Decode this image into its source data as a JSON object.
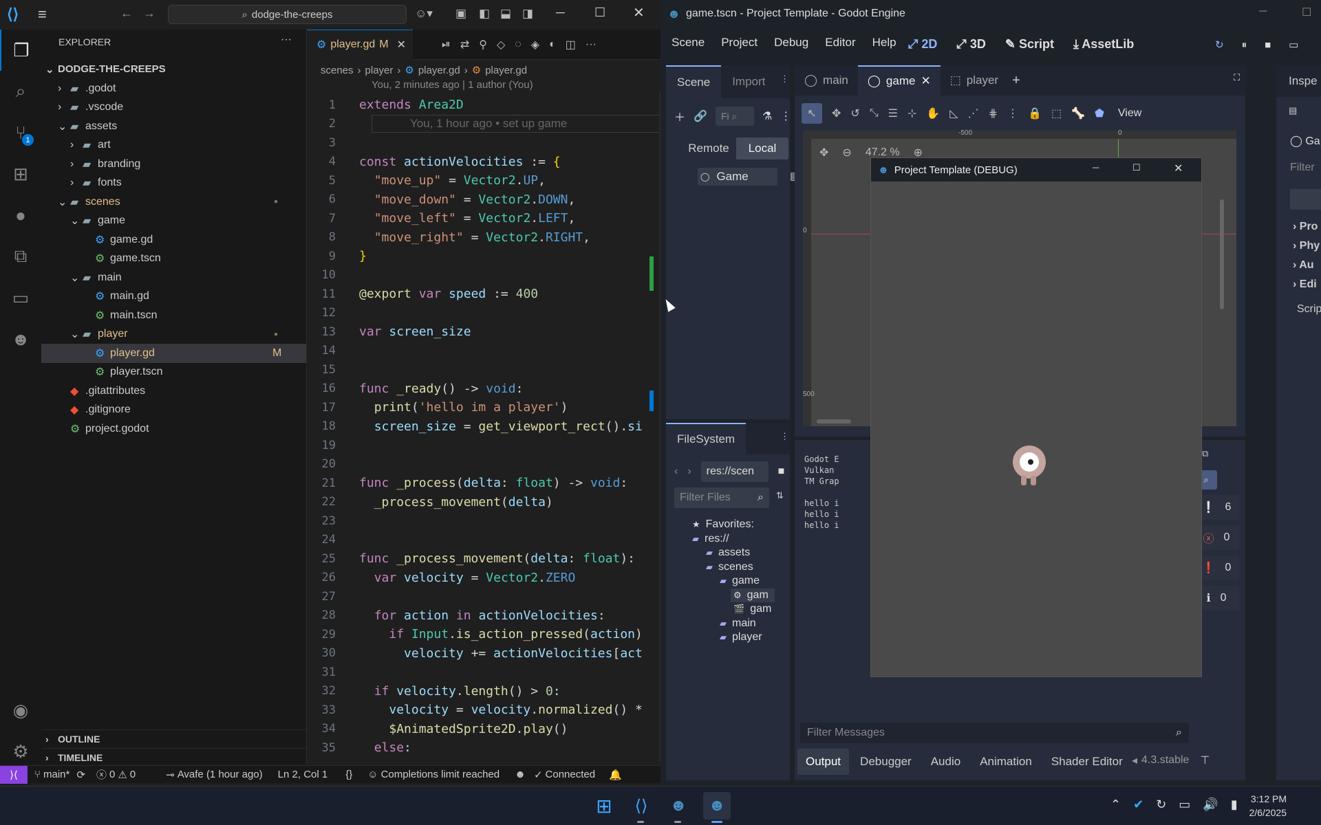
{
  "vscode": {
    "search": "dodge-the-creeps",
    "explorer_title": "EXPLORER",
    "root": "DODGE-THE-CREEPS",
    "tree": [
      {
        "label": ".godot",
        "depth": 1,
        "kind": "folder-closed",
        "color": "#ccc"
      },
      {
        "label": ".vscode",
        "depth": 1,
        "kind": "folder-closed",
        "color": "#ccc"
      },
      {
        "label": "assets",
        "depth": 1,
        "kind": "folder-open",
        "color": "#ccc"
      },
      {
        "label": "art",
        "depth": 2,
        "kind": "folder-closed",
        "color": "#ccc"
      },
      {
        "label": "branding",
        "depth": 2,
        "kind": "folder-closed",
        "color": "#ccc"
      },
      {
        "label": "fonts",
        "depth": 2,
        "kind": "folder-closed",
        "color": "#ccc"
      },
      {
        "label": "scenes",
        "depth": 1,
        "kind": "folder-open",
        "color": "#e2c08d",
        "dot": true
      },
      {
        "label": "game",
        "depth": 2,
        "kind": "folder-open",
        "color": "#ccc"
      },
      {
        "label": "game.gd",
        "depth": 3,
        "kind": "gd",
        "color": "#ccc"
      },
      {
        "label": "game.tscn",
        "depth": 3,
        "kind": "tscn",
        "color": "#ccc"
      },
      {
        "label": "main",
        "depth": 2,
        "kind": "folder-open",
        "color": "#ccc"
      },
      {
        "label": "main.gd",
        "depth": 3,
        "kind": "gd",
        "color": "#ccc"
      },
      {
        "label": "main.tscn",
        "depth": 3,
        "kind": "tscn",
        "color": "#ccc"
      },
      {
        "label": "player",
        "depth": 2,
        "kind": "folder-open",
        "color": "#e2c08d",
        "dot": true
      },
      {
        "label": "player.gd",
        "depth": 3,
        "kind": "gd",
        "color": "#e2c08d",
        "badge": "M",
        "selected": true
      },
      {
        "label": "player.tscn",
        "depth": 3,
        "kind": "tscn",
        "color": "#ccc"
      },
      {
        "label": ".gitattributes",
        "depth": 1,
        "kind": "git",
        "color": "#ccc"
      },
      {
        "label": ".gitignore",
        "depth": 1,
        "kind": "git",
        "color": "#ccc"
      },
      {
        "label": "project.godot",
        "depth": 1,
        "kind": "tscn",
        "color": "#ccc"
      }
    ],
    "outline": "OUTLINE",
    "timeline": "TIMELINE",
    "tab_label": "player.gd",
    "tab_badge": "M",
    "breadcrumb": [
      "scenes",
      "player",
      "player.gd",
      "player.gd"
    ],
    "blame": "You, 2 minutes ago | 1 author (You)",
    "inline_blame": "You, 1 hour ago • set up game",
    "code": [
      [
        [
          "kw",
          "extends "
        ],
        [
          "ty",
          "Area2D"
        ]
      ],
      [],
      [],
      [
        [
          "kw",
          "const "
        ],
        [
          "vr",
          "actionVelocities"
        ],
        [
          "pl",
          " := "
        ],
        [
          "yl",
          "{"
        ]
      ],
      [
        [
          "pl",
          "  "
        ],
        [
          "st",
          "\"move_up\""
        ],
        [
          "pl",
          " = "
        ],
        [
          "ty",
          "Vector2"
        ],
        [
          "pl",
          "."
        ],
        [
          "kw2",
          "UP"
        ],
        [
          "pl",
          ","
        ]
      ],
      [
        [
          "pl",
          "  "
        ],
        [
          "st",
          "\"move_down\""
        ],
        [
          "pl",
          " = "
        ],
        [
          "ty",
          "Vector2"
        ],
        [
          "pl",
          "."
        ],
        [
          "kw2",
          "DOWN"
        ],
        [
          "pl",
          ","
        ]
      ],
      [
        [
          "pl",
          "  "
        ],
        [
          "st",
          "\"move_left\""
        ],
        [
          "pl",
          " = "
        ],
        [
          "ty",
          "Vector2"
        ],
        [
          "pl",
          "."
        ],
        [
          "kw2",
          "LEFT"
        ],
        [
          "pl",
          ","
        ]
      ],
      [
        [
          "pl",
          "  "
        ],
        [
          "st",
          "\"move_right\""
        ],
        [
          "pl",
          " = "
        ],
        [
          "ty",
          "Vector2"
        ],
        [
          "pl",
          "."
        ],
        [
          "kw2",
          "RIGHT"
        ],
        [
          "pl",
          ","
        ]
      ],
      [
        [
          "yl",
          "}"
        ]
      ],
      [],
      [
        [
          "fn",
          "@export "
        ],
        [
          "kw",
          "var "
        ],
        [
          "vr",
          "speed"
        ],
        [
          "pl",
          " := "
        ],
        [
          "nu",
          "400"
        ]
      ],
      [],
      [
        [
          "kw",
          "var "
        ],
        [
          "vr",
          "screen_size"
        ]
      ],
      [],
      [],
      [
        [
          "kw",
          "func "
        ],
        [
          "fn",
          "_ready"
        ],
        [
          "pl",
          "() -> "
        ],
        [
          "kw2",
          "void"
        ],
        [
          "pl",
          ":"
        ]
      ],
      [
        [
          "pl",
          "  "
        ],
        [
          "fn",
          "print"
        ],
        [
          "pl",
          "("
        ],
        [
          "st",
          "'hello im a player'"
        ],
        [
          "pl",
          ")"
        ]
      ],
      [
        [
          "pl",
          "  "
        ],
        [
          "vr",
          "screen_size"
        ],
        [
          "pl",
          " = "
        ],
        [
          "fn",
          "get_viewport_rect"
        ],
        [
          "pl",
          "()."
        ],
        [
          "vr",
          "si"
        ]
      ],
      [],
      [],
      [
        [
          "kw",
          "func "
        ],
        [
          "fn",
          "_process"
        ],
        [
          "pl",
          "("
        ],
        [
          "vr",
          "delta"
        ],
        [
          "pl",
          ": "
        ],
        [
          "ty",
          "float"
        ],
        [
          "pl",
          ") -> "
        ],
        [
          "kw2",
          "void"
        ],
        [
          "pl",
          ":"
        ]
      ],
      [
        [
          "pl",
          "  "
        ],
        [
          "fn",
          "_process_movement"
        ],
        [
          "pl",
          "("
        ],
        [
          "vr",
          "delta"
        ],
        [
          "pl",
          ")"
        ]
      ],
      [],
      [],
      [
        [
          "kw",
          "func "
        ],
        [
          "fn",
          "_process_movement"
        ],
        [
          "pl",
          "("
        ],
        [
          "vr",
          "delta"
        ],
        [
          "pl",
          ": "
        ],
        [
          "ty",
          "float"
        ],
        [
          "pl",
          "):"
        ]
      ],
      [
        [
          "pl",
          "  "
        ],
        [
          "kw",
          "var "
        ],
        [
          "vr",
          "velocity"
        ],
        [
          "pl",
          " = "
        ],
        [
          "ty",
          "Vector2"
        ],
        [
          "pl",
          "."
        ],
        [
          "kw2",
          "ZERO"
        ]
      ],
      [],
      [
        [
          "pl",
          "  "
        ],
        [
          "kw",
          "for "
        ],
        [
          "vr",
          "action"
        ],
        [
          "kw",
          " in "
        ],
        [
          "vr",
          "actionVelocities"
        ],
        [
          "pl",
          ":"
        ]
      ],
      [
        [
          "pl",
          "    "
        ],
        [
          "kw",
          "if "
        ],
        [
          "ty",
          "Input"
        ],
        [
          "pl",
          "."
        ],
        [
          "fn",
          "is_action_pressed"
        ],
        [
          "pl",
          "("
        ],
        [
          "vr",
          "action"
        ],
        [
          "pl",
          ")"
        ]
      ],
      [
        [
          "pl",
          "      "
        ],
        [
          "vr",
          "velocity"
        ],
        [
          "pl",
          " += "
        ],
        [
          "vr",
          "actionVelocities"
        ],
        [
          "pl",
          "["
        ],
        [
          "vr",
          "act"
        ]
      ],
      [],
      [
        [
          "pl",
          "  "
        ],
        [
          "kw",
          "if "
        ],
        [
          "vr",
          "velocity"
        ],
        [
          "pl",
          "."
        ],
        [
          "fn",
          "length"
        ],
        [
          "pl",
          "() > "
        ],
        [
          "nu",
          "0"
        ],
        [
          "pl",
          ":"
        ]
      ],
      [
        [
          "pl",
          "    "
        ],
        [
          "vr",
          "velocity"
        ],
        [
          "pl",
          " = "
        ],
        [
          "vr",
          "velocity"
        ],
        [
          "pl",
          "."
        ],
        [
          "fn",
          "normalized"
        ],
        [
          "pl",
          "() *"
        ]
      ],
      [
        [
          "pl",
          "    "
        ],
        [
          "fn",
          "$AnimatedSprite2D"
        ],
        [
          "pl",
          "."
        ],
        [
          "fn",
          "play"
        ],
        [
          "pl",
          "()"
        ]
      ],
      [
        [
          "pl",
          "  "
        ],
        [
          "kw",
          "else"
        ],
        [
          "pl",
          ":"
        ]
      ]
    ],
    "status": {
      "branch": "main*",
      "problems_err": "0",
      "problems_warn": "0",
      "blame": "Avafe (1 hour ago)",
      "position": "Ln 2, Col 1",
      "completions": "Completions limit reached",
      "connected": "Connected"
    }
  },
  "godot": {
    "title": "game.tscn - Project Template - Godot Engine",
    "menu": [
      "Scene",
      "Project",
      "Debug",
      "Editor",
      "Help"
    ],
    "modes": [
      "2D",
      "3D",
      "Script",
      "AssetLib"
    ],
    "dock_tabs": [
      "Scene",
      "Import"
    ],
    "remote": "Remote",
    "local": "Local",
    "node": "Game",
    "filter_ph": "Fi",
    "editor_tabs": [
      "main",
      "game",
      "player"
    ],
    "zoom": "47.2 %",
    "view": "View",
    "ruler": [
      "-500",
      "0",
      "500",
      "0"
    ],
    "inspector": "Inspe",
    "inspector_items": [
      "Ga",
      "Filter",
      "Pro",
      "Phy",
      "Au",
      "Edi",
      "Scrip"
    ],
    "filesystem": "FileSystem",
    "fs_path": "res://scen",
    "fs_filter": "Filter Files",
    "fs_tree": [
      {
        "label": "Favorites:",
        "depth": 0,
        "icon": "★"
      },
      {
        "label": "res://",
        "depth": 0,
        "icon": "▸"
      },
      {
        "label": "assets",
        "depth": 1,
        "icon": "▸"
      },
      {
        "label": "scenes",
        "depth": 1,
        "icon": "▾"
      },
      {
        "label": "game",
        "depth": 2,
        "icon": "▾"
      },
      {
        "label": "gam",
        "depth": 3,
        "icon": "⚙",
        "selected": true
      },
      {
        "label": "gam",
        "depth": 3,
        "icon": "🎬"
      },
      {
        "label": "main",
        "depth": 2,
        "icon": "▸"
      },
      {
        "label": "player",
        "depth": 2,
        "icon": "▸"
      }
    ],
    "output_lines": [
      "Godot E",
      "Vulkan",
      "TM Grap",
      "",
      "hello i",
      "hello i",
      "hello i"
    ],
    "counts": [
      "6",
      "0",
      "0",
      "0"
    ],
    "filter_messages": "Filter Messages",
    "bottom_tabs": [
      "Output",
      "Debugger",
      "Audio",
      "Animation",
      "Shader Editor"
    ],
    "version": "4.3.stable",
    "debug_title": "Project Template (DEBUG)"
  },
  "taskbar": {
    "time": "3:12 PM",
    "date": "2/6/2025"
  }
}
